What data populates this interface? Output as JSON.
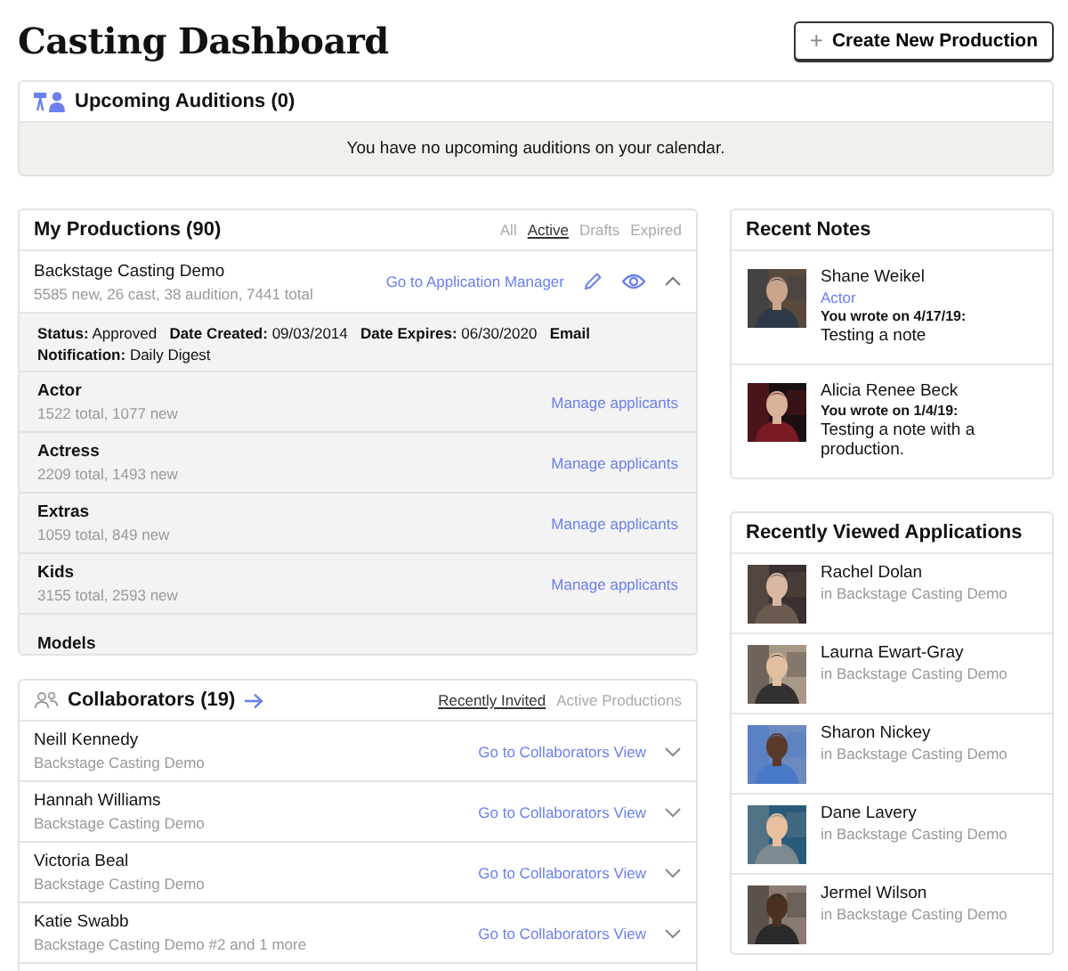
{
  "page_title": "Casting Dashboard",
  "create_button": {
    "icon": "+",
    "label": "Create New Production"
  },
  "upcoming_auditions": {
    "title": "Upcoming Auditions (0)",
    "empty_message": "You have no upcoming auditions on your calendar."
  },
  "my_productions": {
    "title": "My Productions (90)",
    "filters": [
      {
        "label": "All",
        "selected": false
      },
      {
        "label": "Active",
        "selected": true
      },
      {
        "label": "Drafts",
        "selected": false
      },
      {
        "label": "Expired",
        "selected": false
      }
    ],
    "production": {
      "name": "Backstage Casting Demo",
      "stats": "5585 new, 26 cast, 38 audition, 7441 total",
      "link": "Go to Application Manager",
      "expanded": true,
      "details": "**Status:** Approved   **Date Created:** 09/03/2014   **Date Expires:** 06/30/2020   **Email Notification:** Daily Digest"
    },
    "roles": [
      {
        "name": "Actor",
        "counts": "1522 total, 1077 new",
        "link": "Manage applicants"
      },
      {
        "name": "Actress",
        "counts": "2209 total, 1493 new",
        "link": "Manage applicants"
      },
      {
        "name": "Extras",
        "counts": "1059 total, 849 new",
        "link": "Manage applicants"
      },
      {
        "name": "Kids",
        "counts": "3155 total, 2593 new",
        "link": "Manage applicants"
      },
      {
        "name": "Models"
      }
    ]
  },
  "collaborators": {
    "title": "Collaborators (19)",
    "tabs": [
      {
        "label": "Recently Invited",
        "selected": true
      },
      {
        "label": "Active Productions",
        "selected": false
      }
    ],
    "rows": [
      {
        "name": "Neill Kennedy",
        "production": "Backstage Casting Demo",
        "link": "Go to Collaborators View",
        "expanded": false
      },
      {
        "name": "Hannah Williams",
        "production": "Backstage Casting Demo",
        "link": "Go to Collaborators View",
        "expanded": false
      },
      {
        "name": "Victoria Beal",
        "production": "Backstage Casting Demo",
        "link": "Go to Collaborators View",
        "expanded": false
      },
      {
        "name": "Katie Swabb",
        "production": "Backstage Casting Demo #2 and 1 more",
        "link": "Go to Collaborators View",
        "expanded": false
      }
    ]
  },
  "recent_notes": {
    "title": "Recent Notes",
    "notes": [
      {
        "name": "Shane Weikel",
        "role": "Actor",
        "wrote": "You wrote on 4/17/19:",
        "text": "Testing a note"
      },
      {
        "name": "Alicia Renee Beck",
        "wrote": "You wrote on 1/4/19:",
        "text": "Testing a note with a production."
      }
    ]
  },
  "recently_viewed": {
    "title": "Recently Viewed Applications",
    "items": [
      {
        "name": "Rachel Dolan",
        "production": "in Backstage Casting Demo"
      },
      {
        "name": "Laurna Ewart-Gray",
        "production": "in Backstage Casting Demo"
      },
      {
        "name": "Sharon Nickey",
        "production": "in Backstage Casting Demo"
      },
      {
        "name": "Dane Lavery",
        "production": "in Backstage Casting Demo"
      },
      {
        "name": "Jermel Wilson",
        "production": "in Backstage Casting Demo"
      }
    ]
  }
}
